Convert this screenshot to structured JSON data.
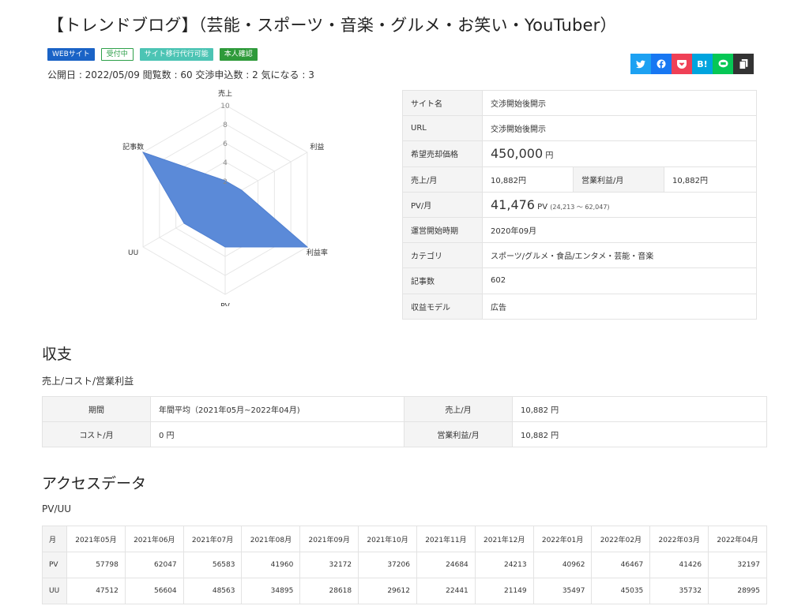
{
  "title": "【トレンドブログ】（芸能・スポーツ・音楽・グルメ・お笑い・YouTuber）",
  "badges": [
    "WEBサイト",
    "受付中",
    "サイト移行代行可能",
    "本人確認"
  ],
  "meta": "公開日 : 2022/05/09  閲覧数 : 60  交渉申込数 : 2  気になる : 3",
  "share_icons": [
    "twitter-icon",
    "facebook-icon",
    "pocket-icon",
    "hatena-icon",
    "line-icon",
    "copy-icon"
  ],
  "share_labels": {
    "hatena": "B!"
  },
  "radar": {
    "ticks": [
      "2",
      "4",
      "6",
      "8",
      "10"
    ],
    "axes": [
      "売上",
      "利益",
      "利益率",
      "PV",
      "UU",
      "記事数"
    ],
    "values": [
      2,
      2,
      10,
      5,
      5,
      10
    ],
    "max": 10,
    "fill": "#5b8ad8"
  },
  "info": {
    "site_name_label": "サイト名",
    "site_name_value": "交渉開始後開示",
    "url_label": "URL",
    "url_value": "交渉開始後開示",
    "price_label": "希望売却価格",
    "price_value": "450,000",
    "price_unit": "円",
    "sales_label": "売上/月",
    "sales_value": "10,882円",
    "profit_label": "営業利益/月",
    "profit_value": "10,882円",
    "pv_label": "PV/月",
    "pv_value": "41,476",
    "pv_unit": "PV",
    "pv_range": "(24,213 ～ 62,047)",
    "start_label": "運営開始時期",
    "start_value": "2020年09月",
    "category_label": "カテゴリ",
    "category_value": "スポーツ/グルメ・食品/エンタメ・芸能・音楽",
    "articles_label": "記事数",
    "articles_value": "602",
    "model_label": "収益モデル",
    "model_value": "広告"
  },
  "shushi": {
    "heading": "収支",
    "subheading": "売上/コスト/営業利益",
    "period_label": "期間",
    "period_value": "年間平均（2021年05月~2022年04月)",
    "sales_label": "売上/月",
    "sales_value": "10,882 円",
    "cost_label": "コスト/月",
    "cost_value": "0 円",
    "profit_label": "営業利益/月",
    "profit_value": "10,882 円"
  },
  "access": {
    "heading": "アクセスデータ",
    "subheading": "PV/UU",
    "month_label": "月",
    "months": [
      "2021年05月",
      "2021年06月",
      "2021年07月",
      "2021年08月",
      "2021年09月",
      "2021年10月",
      "2021年11月",
      "2021年12月",
      "2022年01月",
      "2022年02月",
      "2022年03月",
      "2022年04月"
    ],
    "rows": [
      {
        "label": "PV",
        "values": [
          "57798",
          "62047",
          "56583",
          "41960",
          "32172",
          "37206",
          "24684",
          "24213",
          "40962",
          "46467",
          "41426",
          "32197"
        ]
      },
      {
        "label": "UU",
        "values": [
          "47512",
          "56604",
          "48563",
          "34895",
          "28618",
          "29612",
          "22441",
          "21149",
          "35497",
          "45035",
          "35732",
          "28995"
        ]
      }
    ]
  }
}
